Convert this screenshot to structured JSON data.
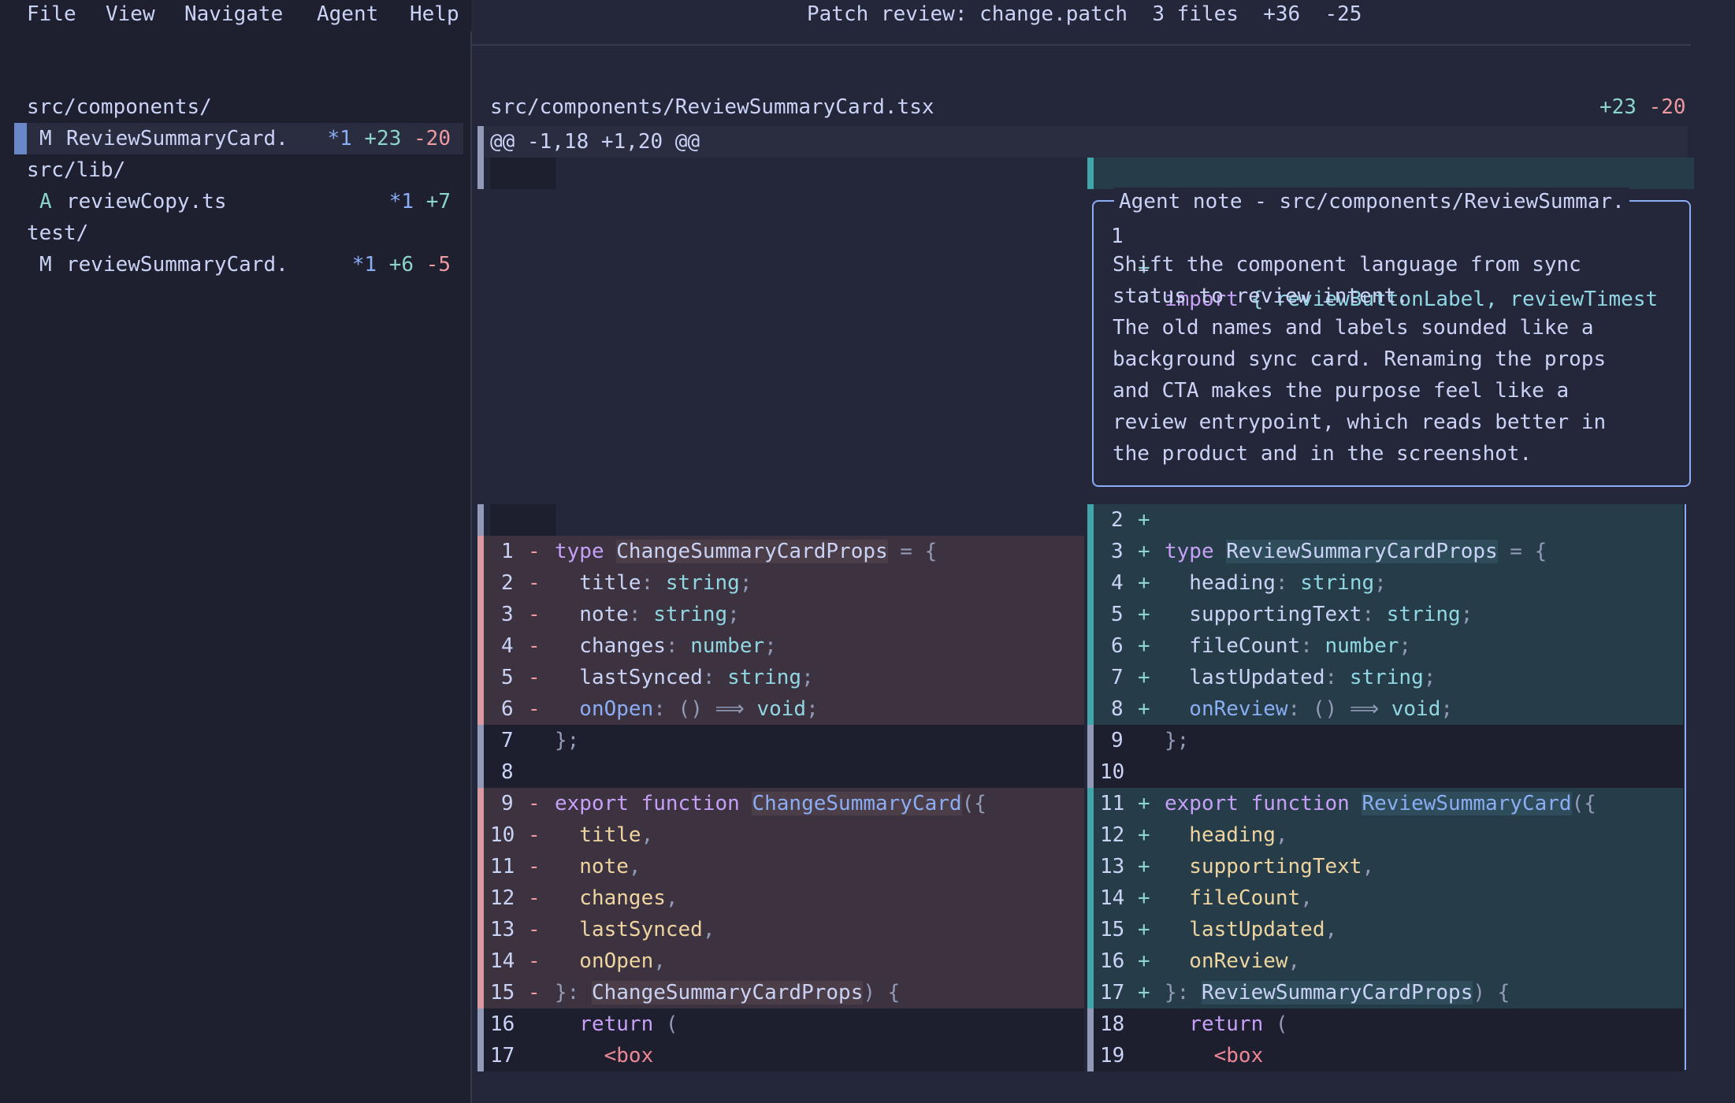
{
  "menu": [
    "File",
    "View",
    "Navigate",
    "Agent",
    "Help"
  ],
  "title": {
    "prefix": "Patch review: change.patch",
    "files": "3 files",
    "added": "+36",
    "removed": "-25"
  },
  "sidebar": {
    "groups": [
      {
        "dir": "src/components/",
        "files": [
          {
            "status": "M",
            "name": "ReviewSummaryCard.",
            "note": "*1",
            "added": "+23",
            "removed": "-20",
            "selected": true
          }
        ]
      },
      {
        "dir": "src/lib/",
        "files": [
          {
            "status": "A",
            "name": "reviewCopy.ts",
            "note": "*1",
            "added": "+7",
            "removed": "",
            "selected": false
          }
        ]
      },
      {
        "dir": "test/",
        "files": [
          {
            "status": "M",
            "name": "reviewSummaryCard.",
            "note": "*1",
            "added": "+6",
            "removed": "-5",
            "selected": false
          }
        ]
      }
    ]
  },
  "diff": {
    "file_path": "src/components/ReviewSummaryCard.tsx",
    "added": "+23",
    "removed": "-20",
    "hunk": "@@ -1,18 +1,20 @@",
    "import_line": {
      "num": "1",
      "sign": "+",
      "kw": "import",
      "text": " { reviewButtonLabel, reviewTimest"
    },
    "note": {
      "title": "Agent note - src/components/ReviewSummar.",
      "lines": [
        "",
        "Shift the component language from sync",
        "status to review intent.",
        "The old names and labels sounded like a",
        "background sync card. Renaming the props",
        "and CTA makes the purpose feel like a",
        "review entrypoint, which reads better in",
        "the product and in the screenshot."
      ]
    },
    "left": [
      {
        "num": "",
        "sign": "",
        "kind": "hunkpad",
        "code": []
      },
      {
        "num": "1",
        "sign": "-",
        "kind": "del",
        "code": [
          [
            "kw",
            "type "
          ],
          [
            "hl",
            "ChangeSummaryCardProps"
          ],
          [
            "pu",
            " = {"
          ]
        ]
      },
      {
        "num": "2",
        "sign": "-",
        "kind": "del",
        "code": [
          [
            "id",
            "  title"
          ],
          [
            "pu",
            ": "
          ],
          [
            "ty",
            "string"
          ],
          [
            "pu",
            ";"
          ]
        ]
      },
      {
        "num": "3",
        "sign": "-",
        "kind": "del",
        "code": [
          [
            "id",
            "  note"
          ],
          [
            "pu",
            ": "
          ],
          [
            "ty",
            "string"
          ],
          [
            "pu",
            ";"
          ]
        ]
      },
      {
        "num": "4",
        "sign": "-",
        "kind": "del",
        "code": [
          [
            "id",
            "  changes"
          ],
          [
            "pu",
            ": "
          ],
          [
            "ty",
            "number"
          ],
          [
            "pu",
            ";"
          ]
        ]
      },
      {
        "num": "5",
        "sign": "-",
        "kind": "del",
        "code": [
          [
            "id",
            "  lastSynced"
          ],
          [
            "pu",
            ": "
          ],
          [
            "ty",
            "string"
          ],
          [
            "pu",
            ";"
          ]
        ]
      },
      {
        "num": "6",
        "sign": "-",
        "kind": "del",
        "code": [
          [
            "fn",
            "  onOpen"
          ],
          [
            "pu",
            ": () ⟹ "
          ],
          [
            "ty",
            "void"
          ],
          [
            "pu",
            ";"
          ]
        ]
      },
      {
        "num": "7",
        "sign": "",
        "kind": "ctx",
        "code": [
          [
            "pu",
            "};"
          ]
        ]
      },
      {
        "num": "8",
        "sign": "",
        "kind": "ctx",
        "code": []
      },
      {
        "num": "9",
        "sign": "-",
        "kind": "del",
        "code": [
          [
            "kw",
            "export "
          ],
          [
            "kw",
            "function "
          ],
          [
            "fnhl",
            "ChangeSummaryCard"
          ],
          [
            "pu",
            "({"
          ]
        ]
      },
      {
        "num": "10",
        "sign": "-",
        "kind": "del",
        "code": [
          [
            "pr",
            "  title"
          ],
          [
            "pu",
            ","
          ]
        ]
      },
      {
        "num": "11",
        "sign": "-",
        "kind": "del",
        "code": [
          [
            "pr",
            "  note"
          ],
          [
            "pu",
            ","
          ]
        ]
      },
      {
        "num": "12",
        "sign": "-",
        "kind": "del",
        "code": [
          [
            "pr",
            "  changes"
          ],
          [
            "pu",
            ","
          ]
        ]
      },
      {
        "num": "13",
        "sign": "-",
        "kind": "del",
        "code": [
          [
            "pr",
            "  lastSynced"
          ],
          [
            "pu",
            ","
          ]
        ]
      },
      {
        "num": "14",
        "sign": "-",
        "kind": "del",
        "code": [
          [
            "pr",
            "  onOpen"
          ],
          [
            "pu",
            ","
          ]
        ]
      },
      {
        "num": "15",
        "sign": "-",
        "kind": "del",
        "code": [
          [
            "pu",
            "}: "
          ],
          [
            "hl",
            "ChangeSummaryCardProps"
          ],
          [
            "pu",
            ") {"
          ]
        ]
      },
      {
        "num": "16",
        "sign": "",
        "kind": "ctx",
        "code": [
          [
            "kw",
            "  return "
          ],
          [
            "pu",
            "("
          ]
        ]
      },
      {
        "num": "17",
        "sign": "",
        "kind": "ctx",
        "code": [
          [
            "tag",
            "    <box"
          ]
        ]
      }
    ],
    "right": [
      {
        "num": "2",
        "sign": "+",
        "kind": "add",
        "code": []
      },
      {
        "num": "3",
        "sign": "+",
        "kind": "add",
        "code": [
          [
            "kw",
            "type "
          ],
          [
            "hl",
            "ReviewSummaryCardProps"
          ],
          [
            "pu",
            " = {"
          ]
        ]
      },
      {
        "num": "4",
        "sign": "+",
        "kind": "add",
        "code": [
          [
            "id",
            "  heading"
          ],
          [
            "pu",
            ": "
          ],
          [
            "ty",
            "string"
          ],
          [
            "pu",
            ";"
          ]
        ]
      },
      {
        "num": "5",
        "sign": "+",
        "kind": "add",
        "code": [
          [
            "id",
            "  supportingText"
          ],
          [
            "pu",
            ": "
          ],
          [
            "ty",
            "string"
          ],
          [
            "pu",
            ";"
          ]
        ]
      },
      {
        "num": "6",
        "sign": "+",
        "kind": "add",
        "code": [
          [
            "id",
            "  fileCount"
          ],
          [
            "pu",
            ": "
          ],
          [
            "ty",
            "number"
          ],
          [
            "pu",
            ";"
          ]
        ]
      },
      {
        "num": "7",
        "sign": "+",
        "kind": "add",
        "code": [
          [
            "id",
            "  lastUpdated"
          ],
          [
            "pu",
            ": "
          ],
          [
            "ty",
            "string"
          ],
          [
            "pu",
            ";"
          ]
        ]
      },
      {
        "num": "8",
        "sign": "+",
        "kind": "add",
        "code": [
          [
            "fn",
            "  onReview"
          ],
          [
            "pu",
            ": () ⟹ "
          ],
          [
            "ty",
            "void"
          ],
          [
            "pu",
            ";"
          ]
        ]
      },
      {
        "num": "9",
        "sign": "",
        "kind": "ctx",
        "code": [
          [
            "pu",
            "};"
          ]
        ]
      },
      {
        "num": "10",
        "sign": "",
        "kind": "ctx",
        "code": []
      },
      {
        "num": "11",
        "sign": "+",
        "kind": "add",
        "code": [
          [
            "kw",
            "export "
          ],
          [
            "kw",
            "function "
          ],
          [
            "fnhl",
            "ReviewSummaryCard"
          ],
          [
            "pu",
            "({"
          ]
        ]
      },
      {
        "num": "12",
        "sign": "+",
        "kind": "add",
        "code": [
          [
            "pr",
            "  heading"
          ],
          [
            "pu",
            ","
          ]
        ]
      },
      {
        "num": "13",
        "sign": "+",
        "kind": "add",
        "code": [
          [
            "pr",
            "  supportingText"
          ],
          [
            "pu",
            ","
          ]
        ]
      },
      {
        "num": "14",
        "sign": "+",
        "kind": "add",
        "code": [
          [
            "pr",
            "  fileCount"
          ],
          [
            "pu",
            ","
          ]
        ]
      },
      {
        "num": "15",
        "sign": "+",
        "kind": "add",
        "code": [
          [
            "pr",
            "  lastUpdated"
          ],
          [
            "pu",
            ","
          ]
        ]
      },
      {
        "num": "16",
        "sign": "+",
        "kind": "add",
        "code": [
          [
            "pr",
            "  onReview"
          ],
          [
            "pu",
            ","
          ]
        ]
      },
      {
        "num": "17",
        "sign": "+",
        "kind": "add",
        "code": [
          [
            "pu",
            "}: "
          ],
          [
            "hl",
            "ReviewSummaryCardProps"
          ],
          [
            "pu",
            ") {"
          ]
        ]
      },
      {
        "num": "18",
        "sign": "",
        "kind": "ctx",
        "code": [
          [
            "kw",
            "  return "
          ],
          [
            "pu",
            "("
          ]
        ]
      },
      {
        "num": "19",
        "sign": "",
        "kind": "ctx",
        "code": [
          [
            "tag",
            "    <box"
          ]
        ]
      }
    ]
  }
}
